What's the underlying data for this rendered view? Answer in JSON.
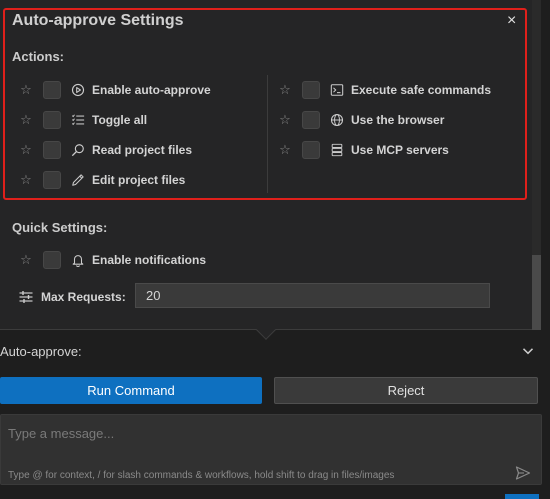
{
  "title": "Auto-approve Settings",
  "close_label": "×",
  "actions_label": "Actions:",
  "actions_left": [
    {
      "label": "Enable auto-approve",
      "icon": "play-circle-icon"
    },
    {
      "label": "Toggle all",
      "icon": "list-check-icon"
    },
    {
      "label": "Read project files",
      "icon": "search-icon"
    },
    {
      "label": "Edit project files",
      "icon": "pencil-icon"
    }
  ],
  "actions_right": [
    {
      "label": "Execute safe commands",
      "icon": "terminal-icon"
    },
    {
      "label": "Use the browser",
      "icon": "globe-icon"
    },
    {
      "label": "Use MCP servers",
      "icon": "server-icon"
    }
  ],
  "quick_settings_label": "Quick Settings:",
  "notifications_label": "Enable notifications",
  "max_requests_label": "Max Requests:",
  "max_requests_value": "20",
  "auto_approve_label": "Auto-approve:",
  "run_command_label": "Run Command",
  "reject_label": "Reject",
  "message_placeholder": "Type a message...",
  "message_hint": "Type @ for context, / for slash commands & workflows, hold shift to drag in files/images",
  "star_glyph": "☆",
  "colors": {
    "accent": "#0e70c0",
    "highlight_border": "#e0201b",
    "panel_bg": "#252526"
  }
}
